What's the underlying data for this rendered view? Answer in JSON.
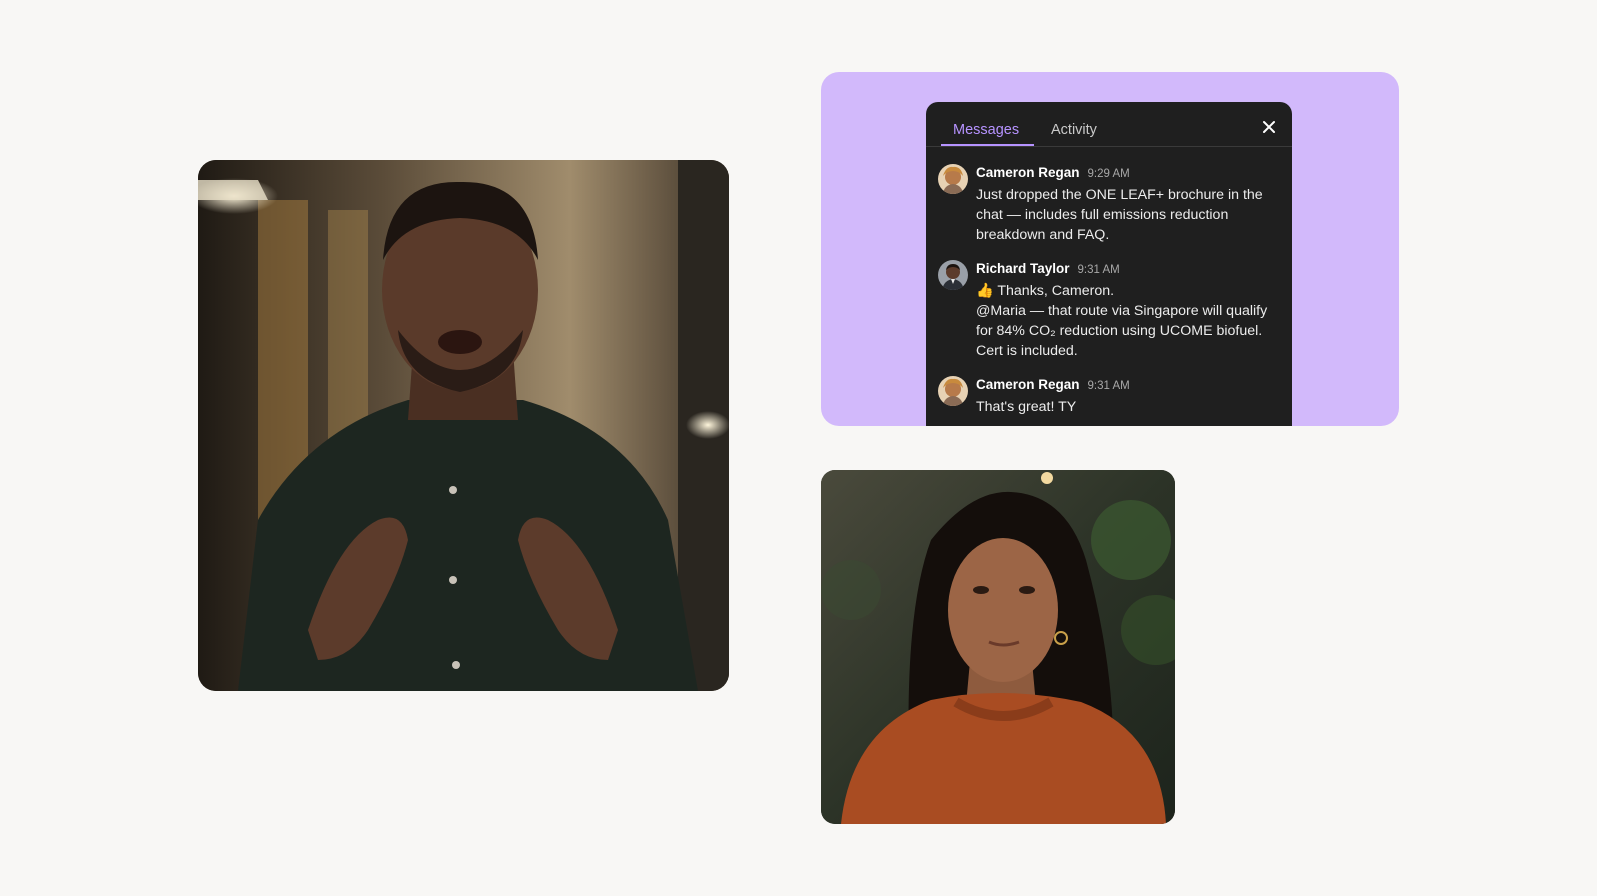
{
  "chat": {
    "tabs": [
      {
        "label": "Messages",
        "active": true
      },
      {
        "label": "Activity",
        "active": false
      }
    ],
    "close_icon": "close-icon",
    "accent_color": "#b693ff",
    "card_background": "#d2b9fb",
    "messages": [
      {
        "author": "Cameron Regan",
        "time": "9:29 AM",
        "text": "Just dropped the ONE LEAF+ brochure in the chat — includes full emissions reduction breakdown and FAQ."
      },
      {
        "author": "Richard Taylor",
        "time": "9:31 AM",
        "text": "👍 Thanks, Cameron.\n @Maria — that route via Singapore will qualify for 84% CO₂ reduction using UCOME biofuel. Cert is included."
      },
      {
        "author": "Cameron Regan",
        "time": "9:31 AM",
        "text": "That's great! TY"
      }
    ]
  }
}
